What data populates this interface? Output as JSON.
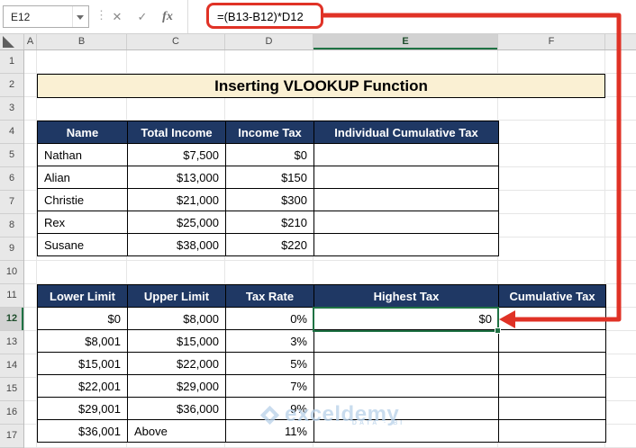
{
  "formula_bar": {
    "name_box_value": "E12",
    "fx_label": "fx",
    "formula": "=(B13-B12)*D12"
  },
  "icons": {
    "grip": "⋮",
    "cancel": "✕",
    "check": "✓"
  },
  "grid": {
    "column_letters": [
      "A",
      "B",
      "C",
      "D",
      "E",
      "F"
    ],
    "row_numbers": [
      "1",
      "2",
      "3",
      "4",
      "5",
      "6",
      "7",
      "8",
      "9",
      "10",
      "11",
      "12",
      "13",
      "14",
      "15",
      "16",
      "17"
    ],
    "selected_cell": "E12"
  },
  "title_banner": "Inserting VLOOKUP Function",
  "income_table": {
    "headers": [
      "Name",
      "Total Income",
      "Income Tax",
      "Individual Cumulative Tax"
    ],
    "rows": [
      [
        "Nathan",
        "$7,500",
        "$0",
        ""
      ],
      [
        "Alian",
        "$13,000",
        "$150",
        ""
      ],
      [
        "Christie",
        "$21,000",
        "$300",
        ""
      ],
      [
        "Rex",
        "$25,000",
        "$210",
        ""
      ],
      [
        "Susane",
        "$38,000",
        "$220",
        ""
      ]
    ]
  },
  "tax_table": {
    "headers": [
      "Lower Limit",
      "Upper Limit",
      "Tax Rate",
      "Highest Tax",
      "Cumulative Tax"
    ],
    "rows": [
      [
        "$0",
        "$8,000",
        "0%",
        "$0",
        ""
      ],
      [
        "$8,001",
        "$15,000",
        "3%",
        "",
        ""
      ],
      [
        "$15,001",
        "$22,000",
        "5%",
        "",
        ""
      ],
      [
        "$22,001",
        "$29,000",
        "7%",
        "",
        ""
      ],
      [
        "$29,001",
        "$36,000",
        "9%",
        "",
        ""
      ],
      [
        "$36,001",
        "Above",
        "11%",
        "",
        ""
      ]
    ]
  },
  "watermark": {
    "brand": "exceldemy",
    "tagline": "DATA · BI"
  },
  "colors": {
    "header_navy": "#1f3864",
    "title_cream": "#faf0d3",
    "selection_green": "#1f7244",
    "annotation_red": "#e03226"
  }
}
